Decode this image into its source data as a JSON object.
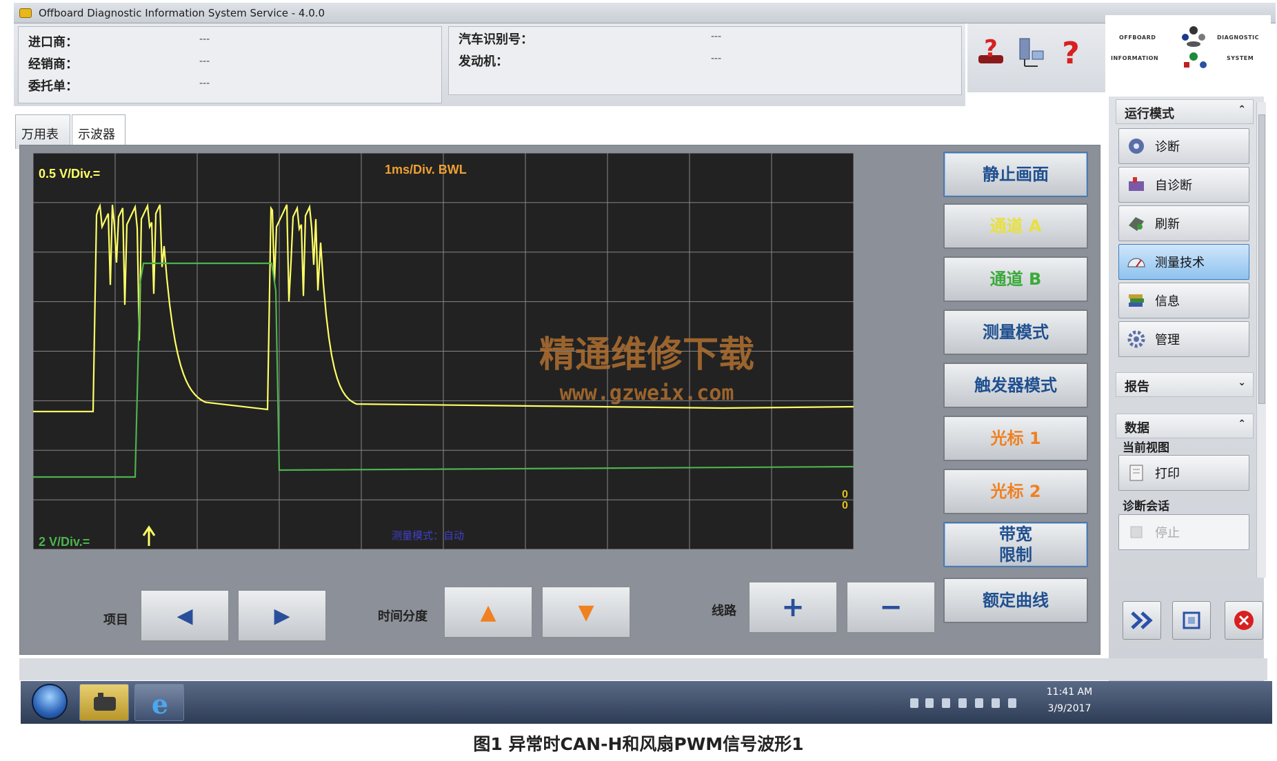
{
  "window": {
    "title": "Offboard Diagnostic Information System Service - 4.0.0"
  },
  "header": {
    "importer_label": "进口商：",
    "importer_value": "---",
    "dealer_label": "经销商：",
    "dealer_value": "---",
    "order_label": "委托单：",
    "order_value": "---",
    "vin_label": "汽车识别号：",
    "vin_value": "---",
    "engine_label": "发动机：",
    "engine_value": "---"
  },
  "logo": {
    "words": [
      "OFFBOARD",
      "DIAGNOSTIC",
      "INFORMATION",
      "SYSTEM"
    ],
    "icons": [
      "audi-logo-icon",
      "vw-logo-icon",
      "bentley-logo-icon",
      "lamborghini-logo-icon",
      "skoda-logo-icon",
      "seat-logo-icon"
    ]
  },
  "tabs": [
    {
      "label": "万用表"
    },
    {
      "label": "示波器"
    }
  ],
  "scope": {
    "label_a": "0.5 V/Div.=",
    "label_b": "2 V/Div.=",
    "timebase": "1ms/Div. BWL",
    "status": "测量模式：自动",
    "zero_marker_1": "0",
    "zero_marker_2": "0",
    "colors": {
      "background": "#222222",
      "grid": "#9a9a9a",
      "channel_a": "#ffff66",
      "channel_b": "#4db34d",
      "info": "#f0a030",
      "status": "#4040c8"
    }
  },
  "watermark": {
    "line1": "精通维修下载",
    "line2": "www.gzweix.com",
    "color": "#b07030"
  },
  "right_buttons": [
    {
      "label": "静止画面",
      "color": "#1f4f8f"
    },
    {
      "label": "通道 A",
      "color": "#e8e040"
    },
    {
      "label": "通道 B",
      "color": "#3aaa3a"
    },
    {
      "label": "测量模式",
      "color": "#1f4f8f"
    },
    {
      "label": "触发器模式",
      "color": "#1f4f8f"
    },
    {
      "label": "光标 1",
      "color": "#f08020"
    },
    {
      "label": "光标 2",
      "color": "#f08020"
    },
    {
      "label": "带宽\n限制",
      "color": "#1f4f8f"
    },
    {
      "label": "额定曲线",
      "color": "#1f4f8f"
    }
  ],
  "bottom": {
    "item_label": "项目",
    "time_label": "时间分度",
    "line_label": "线路",
    "prev_icon": "◀",
    "next_icon": "▶",
    "up_icon": "▲",
    "down_icon": "▼",
    "plus": "+",
    "minus": "−"
  },
  "sidebar": {
    "mode_title": "运行模式",
    "mode_items": [
      {
        "label": "诊断",
        "icon": "diagnosis-icon"
      },
      {
        "label": "自诊断",
        "icon": "self-diagnosis-icon"
      },
      {
        "label": "刷新",
        "icon": "flash-icon"
      },
      {
        "label": "测量技术",
        "icon": "measurement-icon"
      },
      {
        "label": "信息",
        "icon": "info-books-icon"
      },
      {
        "label": "管理",
        "icon": "admin-gear-icon"
      }
    ],
    "report_title": "报告",
    "data_title": "数据",
    "current_view_label": "当前视图",
    "print_label": "打印",
    "session_label": "诊断会话",
    "stop_label": "停止"
  },
  "taskbar": {
    "time": "11:41 AM",
    "date": "3/9/2017"
  },
  "caption": "图1 异常时CAN-H和风扇PWM信号波形1"
}
